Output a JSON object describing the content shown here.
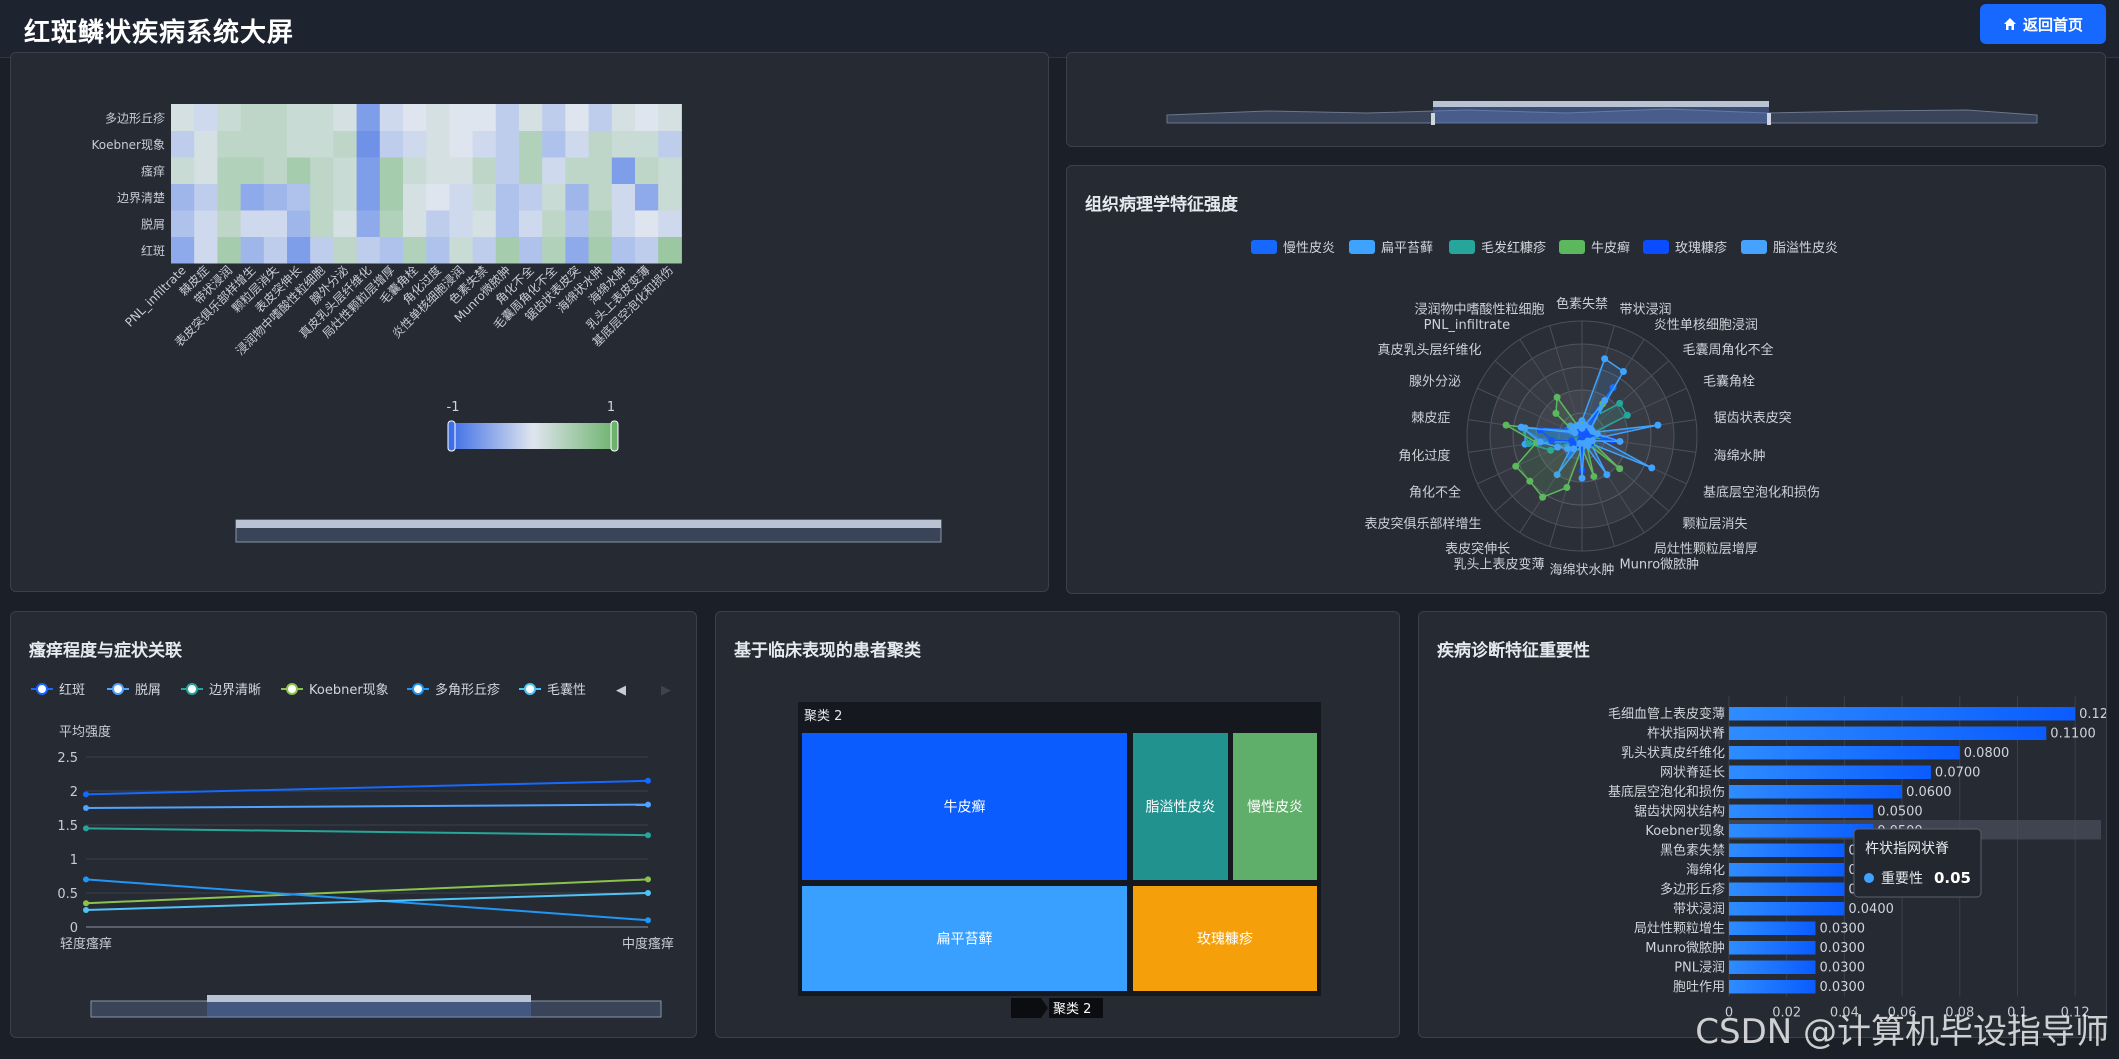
{
  "header": {
    "title": "红斑鳞状疾病系统大屏",
    "home_label": "返回首页",
    "home_icon": "home-icon"
  },
  "heatmap": {
    "row_labels": [
      "红斑",
      "脱屑",
      "边界清楚",
      "瘙痒",
      "Koebner现象",
      "多边形丘疹"
    ],
    "col_labels": [
      "PNL_infiltrate",
      "棘皮症",
      "带状浸润",
      "表皮突俱乐部样增生",
      "颗粒层消失",
      "表皮突伸长",
      "浸润物中嗜酸性粒细胞",
      "腺外分泌",
      "真皮乳头层纤维化",
      "局灶性颗粒层增厚",
      "毛囊角栓",
      "角化过度",
      "炎性单核细胞浸润",
      "色素失禁",
      "Munro微脓肿",
      "角化不全",
      "毛囊周角化不全",
      "锯齿状表皮突",
      "海绵状水肿",
      "海绵水肿",
      "乳头上表皮变薄",
      "基底层空泡化和损伤"
    ],
    "scale_min": "-1",
    "scale_max": "1"
  },
  "radar": {
    "title": "组织病理学特征强度",
    "legend": [
      "慢性皮炎",
      "扁平苔藓",
      "毛发红糠疹",
      "牛皮癣",
      "玫瑰糠疹",
      "脂溢性皮炎"
    ],
    "indicators": [
      "色素失禁",
      "带状浸润",
      "炎性单核细胞浸润",
      "毛囊周角化不全",
      "毛囊角栓",
      "锯齿状表皮突",
      "海绵水肿",
      "基底层空泡化和损伤",
      "颗粒层消失",
      "局灶性颗粒层增厚",
      "Munro微脓肿",
      "海绵状水肿",
      "乳头上表皮变薄",
      "表皮突伸长",
      "表皮突俱乐部样增生",
      "角化不全",
      "角化过度",
      "棘皮症",
      "腺外分泌",
      "真皮乳头层纤维化",
      "PNL_infiltrate",
      "浸润物中嗜酸性粒细胞"
    ]
  },
  "line_panel": {
    "title": "瘙痒程度与症状关联",
    "legend": [
      "红斑",
      "脱屑",
      "边界清晰",
      "Koebner现象",
      "多角形丘疹",
      "毛囊性"
    ],
    "y_axis_name": "平均强度",
    "y_ticks": [
      "2.5",
      "2",
      "1.5",
      "1",
      "0.5",
      "0"
    ]
  },
  "treemap": {
    "title": "基于临床表现的患者聚类",
    "cluster_header": "聚类 2",
    "breadcrumb": "聚类 2",
    "items": [
      "牛皮癣",
      "扁平苔藓",
      "脂溢性皮炎",
      "慢性皮炎",
      "玫瑰糠疹"
    ]
  },
  "importance": {
    "title": "疾病诊断特征重要性",
    "tooltip_title": "杵状指网状脊",
    "tooltip_label": "重要性",
    "tooltip_value": "0.05",
    "x_ticks": [
      "0",
      "0.02",
      "0.04",
      "0.06",
      "0.08",
      "0.1",
      "0.12"
    ],
    "watermark": "CSDN @计算机毕设指导师"
  },
  "chart_data": [
    {
      "type": "heatmap",
      "title": "",
      "y_categories": [
        "红斑",
        "脱屑",
        "边界清楚",
        "瘙痒",
        "Koebner现象",
        "多边形丘疹"
      ],
      "x_categories": [
        "PNL_infiltrate",
        "棘皮症",
        "带状浸润",
        "表皮突俱乐部样增生",
        "颗粒层消失",
        "表皮突伸长",
        "浸润物中嗜酸性粒细胞",
        "腺外分泌",
        "真皮乳头层纤维化",
        "局灶性颗粒层增厚",
        "毛囊角栓",
        "角化过度",
        "炎性单核细胞浸润",
        "色素失禁",
        "Munro微脓肿",
        "角化不全",
        "毛囊周角化不全",
        "锯齿状表皮突",
        "海绵状水肿",
        "海绵水肿",
        "乳头上表皮变薄",
        "基底层空泡化和损伤"
      ],
      "values": [
        [
          -0.5,
          -0.1,
          0.5,
          -0.4,
          -0.2,
          -0.6,
          -0.2,
          0.3,
          -0.2,
          -0.3,
          0.4,
          -0.3,
          0.2,
          -0.2,
          0.5,
          -0.3,
          0.4,
          -0.5,
          0.5,
          -0.3,
          -0.2,
          0.6
        ],
        [
          -0.3,
          -0.1,
          0.3,
          -0.1,
          -0.1,
          -0.4,
          0.3,
          0.1,
          -0.5,
          0.4,
          0.1,
          -0.2,
          -0.1,
          0.1,
          -0.3,
          -0.1,
          0.3,
          -0.3,
          0.4,
          -0.1,
          0.0,
          -0.1
        ],
        [
          -0.4,
          -0.2,
          0.4,
          -0.5,
          -0.4,
          -0.3,
          0.3,
          0.2,
          -0.6,
          0.5,
          0.1,
          0.0,
          -0.1,
          0.2,
          -0.3,
          -0.2,
          0.2,
          -0.4,
          0.3,
          -0.1,
          -0.5,
          0.2
        ],
        [
          0.2,
          0.1,
          0.4,
          0.4,
          0.3,
          0.5,
          0.3,
          0.2,
          -0.6,
          0.5,
          0.2,
          0.1,
          0.1,
          0.3,
          -0.2,
          0.4,
          -0.1,
          0.3,
          0.3,
          -0.6,
          0.3,
          0.2
        ],
        [
          -0.2,
          0.1,
          0.3,
          0.3,
          0.3,
          0.2,
          0.2,
          0.3,
          -0.7,
          -0.2,
          -0.1,
          0.1,
          0.0,
          -0.1,
          -0.2,
          0.4,
          -0.3,
          -0.1,
          0.3,
          0.2,
          0.2,
          -0.2
        ],
        [
          0.1,
          -0.1,
          0.2,
          0.3,
          0.3,
          0.2,
          0.2,
          0.1,
          -0.6,
          -0.1,
          0.0,
          0.1,
          0.0,
          0.0,
          -0.2,
          0.1,
          -0.2,
          0.0,
          -0.2,
          0.1,
          0.0,
          0.1
        ]
      ],
      "visual_map_range": [
        -1,
        1
      ]
    },
    {
      "type": "radar",
      "title": "组织病理学特征强度",
      "indicators": [
        "色素失禁",
        "带状浸润",
        "炎性单核细胞浸润",
        "毛囊周角化不全",
        "毛囊角栓",
        "锯齿状表皮突",
        "海绵水肿",
        "基底层空泡化和损伤",
        "颗粒层消失",
        "局灶性颗粒层增厚",
        "Munro微脓肿",
        "海绵状水肿",
        "乳头上表皮变薄",
        "表皮突伸长",
        "表皮突俱乐部样增生",
        "角化不全",
        "角化过度",
        "棘皮症",
        "腺外分泌",
        "真皮乳头层纤维化",
        "PNL_infiltrate",
        "浸润物中嗜酸性粒细胞"
      ],
      "max": 3,
      "series": [
        {
          "name": "慢性皮炎",
          "values": [
            0.2,
            0.3,
            1.5,
            0.2,
            0.3,
            0.2,
            0.5,
            0.3,
            0.4,
            0.2,
            0.1,
            0.4,
            0.1,
            0.6,
            0.3,
            0.4,
            1.0,
            1.6,
            0.4,
            0.3,
            0.2,
            0.2
          ]
        },
        {
          "name": "扁平苔藓",
          "values": [
            0.4,
            2.1,
            2.0,
            0.3,
            0.2,
            2.0,
            0.4,
            2.0,
            0.3,
            1.2,
            0.2,
            0.3,
            0.3,
            1.2,
            0.3,
            0.3,
            1.5,
            1.5,
            0.3,
            0.4,
            0.2,
            0.3
          ]
        },
        {
          "name": "毛发红糠疹",
          "values": [
            0.2,
            0.2,
            0.6,
            1.3,
            1.3,
            0.2,
            0.2,
            0.1,
            0.1,
            0.3,
            0.1,
            0.2,
            0.1,
            0.3,
            0.2,
            0.9,
            1.4,
            1.6,
            0.2,
            0.3,
            0.1,
            0.2
          ]
        },
        {
          "name": "牛皮癣",
          "values": [
            0.3,
            0.2,
            1.0,
            0.2,
            0.2,
            0.3,
            0.4,
            0.2,
            1.3,
            0.2,
            1.1,
            0.3,
            1.4,
            1.9,
            1.8,
            1.9,
            1.2,
            2.0,
            0.2,
            0.9,
            1.2,
            0.2
          ]
        },
        {
          "name": "玫瑰糠疹",
          "values": [
            0.1,
            0.2,
            0.7,
            0.2,
            0.1,
            0.2,
            0.8,
            0.2,
            0.3,
            0.2,
            0.1,
            0.9,
            0.1,
            0.3,
            0.3,
            0.3,
            0.8,
            1.1,
            0.2,
            0.2,
            0.1,
            0.2
          ]
        },
        {
          "name": "脂溢性皮炎",
          "values": [
            0.2,
            0.3,
            1.1,
            0.3,
            0.3,
            0.4,
            1.0,
            0.3,
            0.2,
            0.3,
            0.2,
            1.1,
            0.2,
            0.4,
            0.5,
            0.7,
            1.1,
            1.6,
            0.2,
            0.3,
            0.3,
            0.3
          ]
        }
      ]
    },
    {
      "type": "line",
      "title": "瘙痒程度与症状关联",
      "x": [
        "轻度瘙痒",
        "中度瘙痒"
      ],
      "ylabel": "平均强度",
      "ylim": [
        0,
        2.5
      ],
      "series": [
        {
          "name": "红斑",
          "values": [
            1.95,
            2.15
          ]
        },
        {
          "name": "脱屑",
          "values": [
            1.75,
            1.8
          ]
        },
        {
          "name": "边界清晰",
          "values": [
            1.45,
            1.35
          ]
        },
        {
          "name": "Koebner现象",
          "values": [
            0.35,
            0.7
          ]
        },
        {
          "name": "多角形丘疹",
          "values": [
            0.7,
            0.1
          ]
        },
        {
          "name": "毛囊性",
          "values": [
            0.25,
            0.5
          ]
        }
      ]
    },
    {
      "type": "treemap",
      "title": "基于临床表现的患者聚类",
      "root": "聚类 2",
      "items": [
        {
          "name": "牛皮癣",
          "value": 111
        },
        {
          "name": "扁平苔藓",
          "value": 71
        },
        {
          "name": "脂溢性皮炎",
          "value": 60
        },
        {
          "name": "慢性皮炎",
          "value": 52
        },
        {
          "name": "玫瑰糠疹",
          "value": 49
        }
      ]
    },
    {
      "type": "bar",
      "orientation": "horizontal",
      "title": "疾病诊断特征重要性",
      "categories": [
        "毛细血管上表皮变薄",
        "杵状指网状脊",
        "乳头状真皮纤维化",
        "网状脊延长",
        "基底层空泡化和损伤",
        "锯齿状网状结构",
        "Koebner现象",
        "黑色素失禁",
        "海绵化",
        "多边形丘疹",
        "带状浸润",
        "局灶性颗粒增生",
        "Munro微脓肿",
        "PNL浸润",
        "胞吐作用"
      ],
      "values": [
        0.12,
        0.11,
        0.08,
        0.07,
        0.06,
        0.05,
        0.05,
        0.04,
        0.04,
        0.04,
        0.04,
        0.03,
        0.03,
        0.03,
        0.03
      ],
      "labels": [
        "0.1200",
        "0.1100",
        "0.0800",
        "0.0700",
        "0.0600",
        "0.0500",
        "0.0500",
        "0.0400",
        "0.0400",
        "0.0400",
        "0.0400",
        "0.0300",
        "0.0300",
        "0.0300",
        "0.0300"
      ],
      "xlim": [
        0,
        0.13
      ]
    }
  ]
}
